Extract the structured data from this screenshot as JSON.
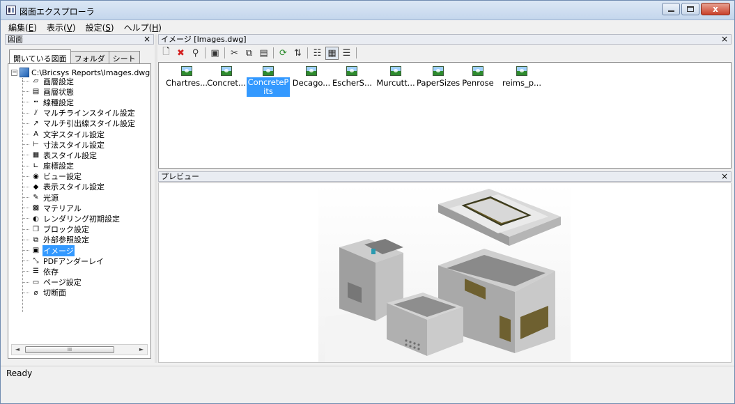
{
  "window": {
    "title": "図面エクスプローラ",
    "close_label": "x"
  },
  "menubar": {
    "items": [
      {
        "label": "編集(",
        "key": "E",
        "end": ")"
      },
      {
        "label": "表示(",
        "key": "V",
        "end": ")"
      },
      {
        "label": "設定(",
        "key": "S",
        "end": ")"
      },
      {
        "label": "ヘルプ(",
        "key": "H",
        "end": ")"
      }
    ]
  },
  "left_panel": {
    "title": "図面",
    "close": "×",
    "tabs": [
      "開いている図面",
      "フォルダ",
      "シート"
    ],
    "active_tab": 0,
    "root": {
      "expander": "−",
      "label": "C:\\Bricsys Reports\\Images.dwg"
    },
    "items": [
      {
        "label": "画層設定",
        "icon": "layer-settings-icon",
        "glyph": "▱"
      },
      {
        "label": "画層状態",
        "icon": "layer-states-icon",
        "glyph": "▤"
      },
      {
        "label": "線種設定",
        "icon": "linetype-icon",
        "glyph": "┅"
      },
      {
        "label": "マルチラインスタイル設定",
        "icon": "multiline-style-icon",
        "glyph": "⫽"
      },
      {
        "label": "マルチ引出線スタイル設定",
        "icon": "multileader-style-icon",
        "glyph": "↗"
      },
      {
        "label": "文字スタイル設定",
        "icon": "text-style-icon",
        "glyph": "A"
      },
      {
        "label": "寸法スタイル設定",
        "icon": "dimension-style-icon",
        "glyph": "⊢"
      },
      {
        "label": "表スタイル設定",
        "icon": "table-style-icon",
        "glyph": "▦"
      },
      {
        "label": "座標設定",
        "icon": "ucs-icon",
        "glyph": "∟"
      },
      {
        "label": "ビュー設定",
        "icon": "view-icon",
        "glyph": "◉"
      },
      {
        "label": "表示スタイル設定",
        "icon": "visual-style-icon",
        "glyph": "◆"
      },
      {
        "label": "光源",
        "icon": "light-icon",
        "glyph": "✎"
      },
      {
        "label": "マテリアル",
        "icon": "material-icon",
        "glyph": "▩"
      },
      {
        "label": "レンダリング初期設定",
        "icon": "render-preset-icon",
        "glyph": "◐"
      },
      {
        "label": "ブロック設定",
        "icon": "block-icon",
        "glyph": "❒"
      },
      {
        "label": "外部参照設定",
        "icon": "xref-icon",
        "glyph": "⧉"
      },
      {
        "label": "イメージ",
        "icon": "image-icon",
        "glyph": "▣",
        "selected": true
      },
      {
        "label": "PDFアンダーレイ",
        "icon": "pdf-underlay-icon",
        "glyph": "⤡"
      },
      {
        "label": "依存",
        "icon": "dependency-icon",
        "glyph": "☰"
      },
      {
        "label": "ページ設定",
        "icon": "page-setup-icon",
        "glyph": "▭"
      },
      {
        "label": "切断面",
        "icon": "section-plane-icon",
        "glyph": "⌀"
      }
    ],
    "scroll_thumb": "III",
    "scroll_left": "◄",
    "scroll_right": "►"
  },
  "images_panel": {
    "title": "イメージ  [Images.dwg]",
    "close": "×",
    "toolbar": [
      {
        "name": "new-button",
        "glyph": "🗋"
      },
      {
        "name": "delete-button",
        "glyph": "✖",
        "color": "#d42020"
      },
      {
        "name": "purge-button",
        "glyph": "⚲"
      },
      {
        "sep": true
      },
      {
        "name": "insert-image-button",
        "glyph": "▣"
      },
      {
        "sep": true
      },
      {
        "name": "cut-button",
        "glyph": "✂"
      },
      {
        "name": "copy-button",
        "glyph": "⧉"
      },
      {
        "name": "paste-button",
        "glyph": "▤"
      },
      {
        "sep": true
      },
      {
        "name": "refresh-button",
        "glyph": "⟳",
        "color": "#2a8a2a"
      },
      {
        "name": "reload-button",
        "glyph": "⇅"
      },
      {
        "sep": true
      },
      {
        "name": "list-view-button",
        "glyph": "☷"
      },
      {
        "name": "icon-view-button",
        "glyph": "▦",
        "active": true
      },
      {
        "name": "detail-view-button",
        "glyph": "☰"
      },
      {
        "sep": true
      }
    ],
    "files": [
      {
        "label": "Chartres..."
      },
      {
        "label": "Concret..."
      },
      {
        "label": "ConcretePits",
        "selected": true
      },
      {
        "label": "Decago..."
      },
      {
        "label": "EscherS..."
      },
      {
        "label": "Murcutt..."
      },
      {
        "label": "PaperSizes"
      },
      {
        "label": "Penrose"
      },
      {
        "label": "reims_p..."
      }
    ]
  },
  "preview_panel": {
    "title": "プレビュー",
    "close": "×"
  },
  "status": {
    "text": "Ready"
  }
}
